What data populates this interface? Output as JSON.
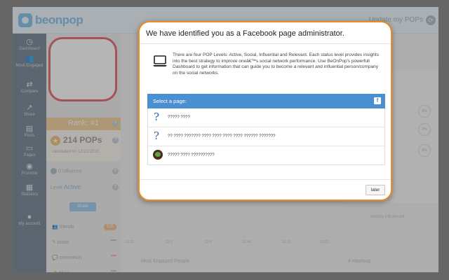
{
  "app": {
    "logo_text": "beonpop",
    "topbar_right": "Update my POPs"
  },
  "sidenav": {
    "items": [
      {
        "label": "Dashboard"
      },
      {
        "label": "Most Engaged"
      },
      {
        "label": "Compare"
      },
      {
        "label": "Share"
      },
      {
        "label": "Posts"
      },
      {
        "label": "Pages"
      },
      {
        "label": "Promote"
      },
      {
        "label": "Statistics"
      },
      {
        "label": "My account"
      }
    ]
  },
  "profile": {
    "rank": "Rank: #1",
    "pops": "214 POPs",
    "calculated": "calculated on 12/22/2015",
    "influence": "0 influence",
    "level_label": "Level",
    "level_value": "Active",
    "share_label": "Share",
    "stats": [
      {
        "label": "friends",
        "badge": "535"
      },
      {
        "label": "posts"
      },
      {
        "label": "comments"
      },
      {
        "label": "likes"
      }
    ]
  },
  "background": {
    "x_ticks": [
      "11:22",
      "12:1",
      "12:4",
      "12:45",
      "12:15",
      "12:22"
    ],
    "percent": [
      "0%",
      "0%",
      "0%"
    ],
    "directly_influenced": "directly influenced",
    "most_engaged": "Most Engaged People",
    "hashtag": "# Hashtag"
  },
  "modal": {
    "title": "We have identified you as a Facebook page administrator.",
    "body": "There are four POP Levels: Active, Social, Influential and Relevant. Each status level provides insights into the best strategy to improve oneâ€™s social network performance. Use BeOnPop's powerfull Dashboard to get information that can guide you to become a relevant and influential person/company on the social networks.",
    "select_label": "Select a page:",
    "pages": [
      {
        "name": "????? ????",
        "icon": "question-icon"
      },
      {
        "name": "?? ???? ??????? ???? ???? ???? ???? ?????? ???????",
        "icon": "question-icon"
      },
      {
        "name": "????? ???? ??????????",
        "icon": "page-avatar"
      }
    ],
    "later_label": "later"
  },
  "colors": {
    "accent": "#f08a24",
    "select_header": "#4a8fd1",
    "avatar_border": "#e04b5a"
  }
}
